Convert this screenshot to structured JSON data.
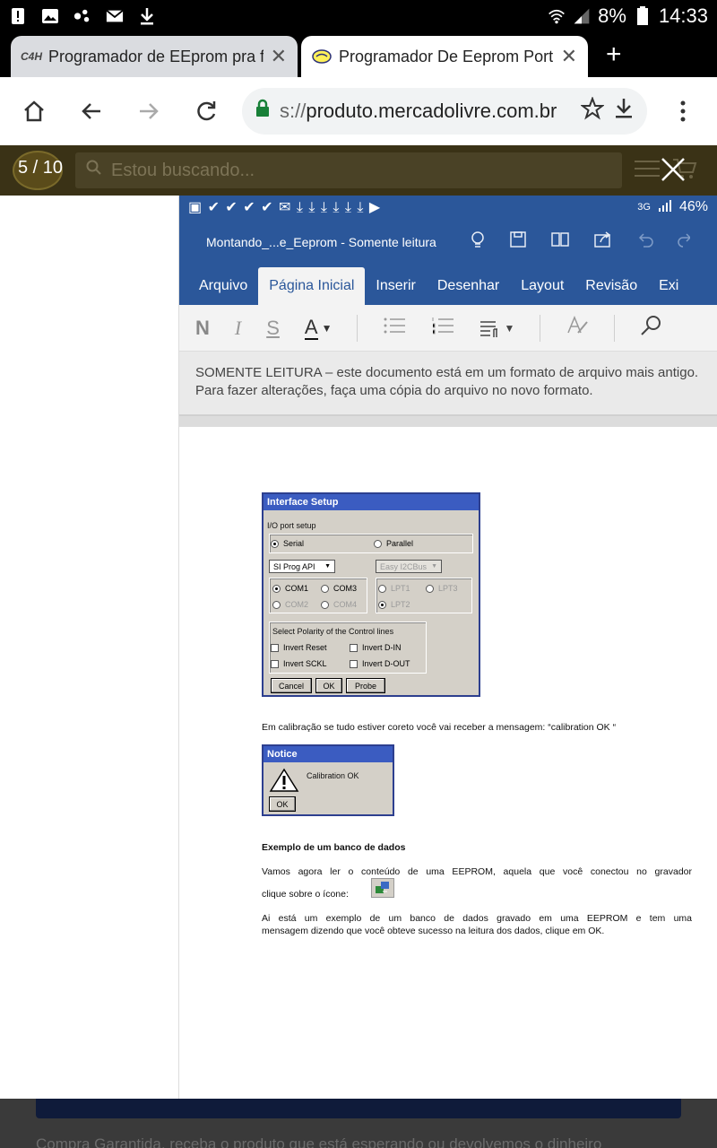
{
  "status_bar": {
    "battery_percent": "8%",
    "time": "14:33"
  },
  "browser": {
    "tabs": [
      {
        "favicon_text": "C4H",
        "title": "Programador de EEprom pra f",
        "active": false
      },
      {
        "favicon_text": "",
        "title": "Programador De Eeprom Port",
        "active": true
      }
    ],
    "url_scheme": "s://",
    "url_host": "produto.mercadolivre.com.br"
  },
  "lightbox": {
    "counter": "5 / 10",
    "search_placeholder": "Estou buscando..."
  },
  "word": {
    "status": {
      "network": "3G",
      "battery": "46%"
    },
    "doc_title": "Montando_...e_Eeprom - Somente leitura",
    "tabs": [
      "Arquivo",
      "Página Inicial",
      "Inserir",
      "Desenhar",
      "Layout",
      "Revisão",
      "Exi"
    ],
    "selected_tab": "Página Inicial",
    "ribbon": {
      "bold": "N",
      "italic": "I",
      "strike": "S",
      "font_color": "A"
    },
    "notice_line1": "SOMENTE LEITURA – este documento está em um formato de arquivo mais antigo.",
    "notice_line2": "Para fazer alterações, faça uma cópia do arquivo no novo formato."
  },
  "interface_setup": {
    "caption": "Interface Setup",
    "group_label": "I/O port setup",
    "serial": "Serial",
    "parallel": "Parallel",
    "serial_api": "SI Prog API",
    "parallel_api": "Easy I2CBus",
    "com1": "COM1",
    "com2": "COM2",
    "com3": "COM3",
    "com4": "COM4",
    "lpt1": "LPT1",
    "lpt2": "LPT2",
    "lpt3": "LPT3",
    "polarity_label": "Select Polarity of the Control lines",
    "invert_reset": "Invert Reset",
    "invert_sckl": "Invert SCKL",
    "invert_din": "Invert D-IN",
    "invert_dout": "Invert D-OUT",
    "cancel": "Cancel",
    "ok": "OK",
    "probe": "Probe"
  },
  "doc": {
    "calibration_text": "Em calibração se tudo estiver coreto você vai receber  a mensagem: “calibration OK  “",
    "notice_caption": "Notice",
    "notice_message": "Calibration OK",
    "notice_ok": "OK",
    "section_title": "Exemplo de um banco de dados",
    "para1_line1": "Vamos agora ler o conteúdo de uma EEPROM, aquela que você conectou no gravador",
    "para1_line2": "clique sobre o ícone:",
    "para2_line1": "Ai está um exemplo de um banco de dados gravado em uma EEPROM e tem uma",
    "para2_line2": "mensagem dizendo que você obteve sucesso na leitura dos dados, clique em OK."
  },
  "background_page": {
    "footer_text": "Compra Garantida, receba o produto que está esperando ou devolvemos o dinheiro"
  }
}
